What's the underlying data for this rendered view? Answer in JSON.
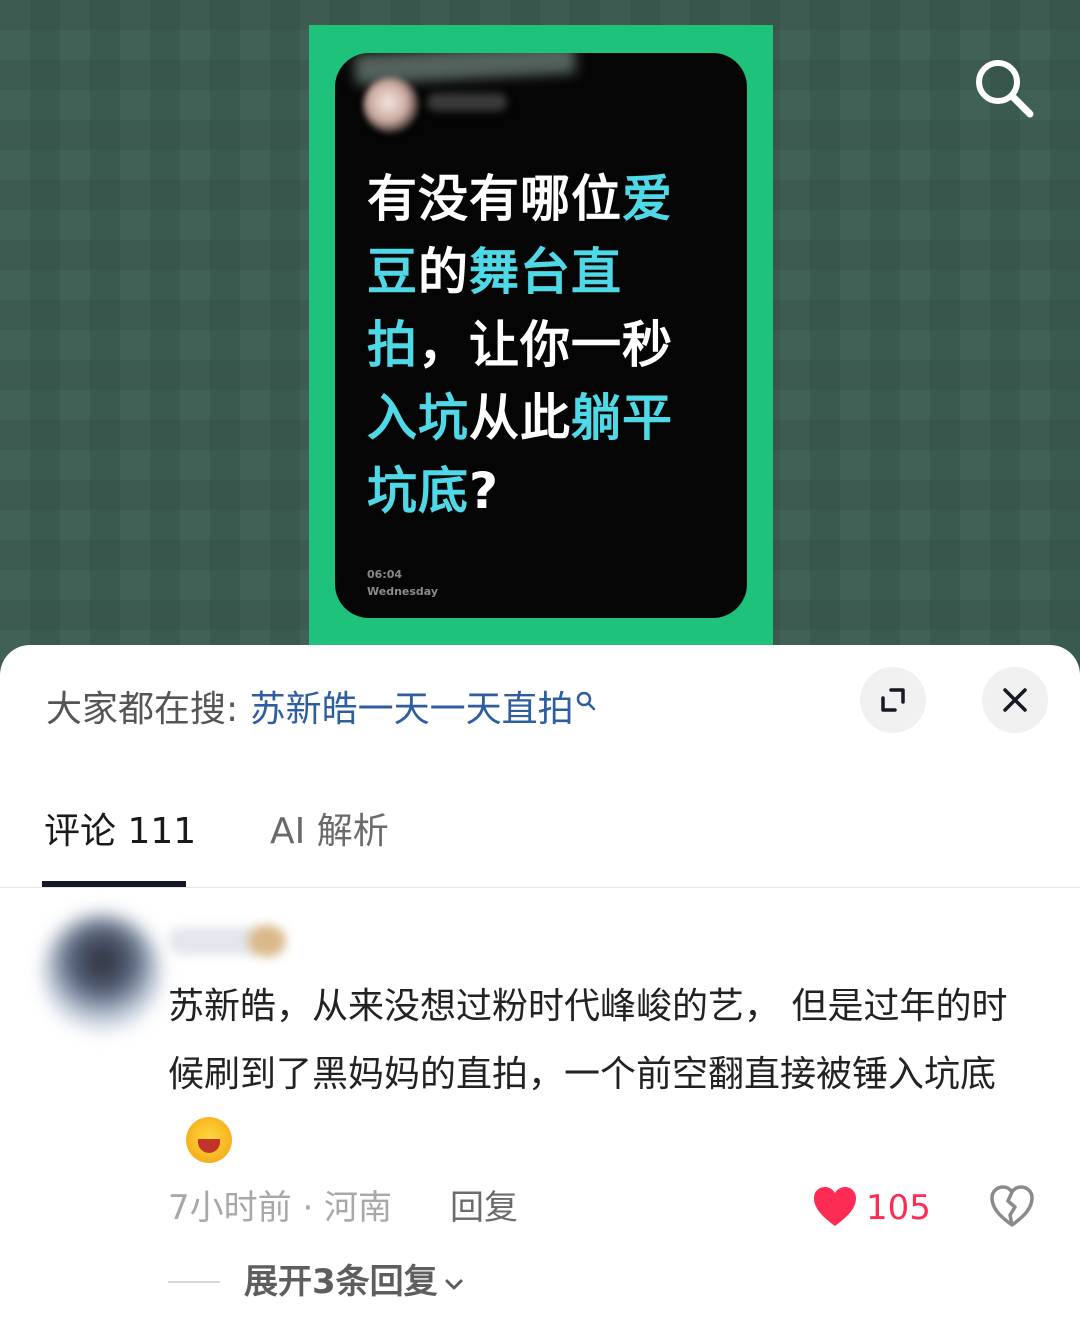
{
  "poster": {
    "headline_parts": [
      {
        "text": "有没有哪位",
        "hl": false
      },
      {
        "text": "爱豆",
        "hl": true
      },
      {
        "text": "的",
        "hl": false
      },
      {
        "text": "舞台直拍",
        "hl": true
      },
      {
        "text": "，让你一秒",
        "hl": false
      },
      {
        "text": "入坑",
        "hl": true
      },
      {
        "text": "从此",
        "hl": false
      },
      {
        "text": "躺平坑底",
        "hl": true
      },
      {
        "text": "?",
        "hl": false
      }
    ],
    "time": "06:04",
    "day": "Wednesday",
    "colors": {
      "frame": "#1ec27a",
      "highlight": "#4fd8e6"
    }
  },
  "top_icons": {
    "search": "search-icon"
  },
  "hot_search": {
    "prefix": "大家都在搜: ",
    "term": "苏新皓一天一天直拍"
  },
  "sheet_icons": {
    "expand": "expand-icon",
    "close": "close-icon"
  },
  "tabs": {
    "comments": "评论 111",
    "ai": "AI 解析"
  },
  "comment": {
    "text": "苏新皓，从来没想过粉时代峰峻的艺， 但是过年的时候刷到了黑妈妈的直拍，一个前空翻直接被锤入坑底",
    "emoji": "laughing-crying-emoji",
    "meta": "7小时前 · 河南",
    "reply_label": "回复",
    "likes": "105",
    "expand_label": "展开3条回复"
  },
  "accent": {
    "like": "#fe2c55",
    "link": "#2f5e9e"
  }
}
